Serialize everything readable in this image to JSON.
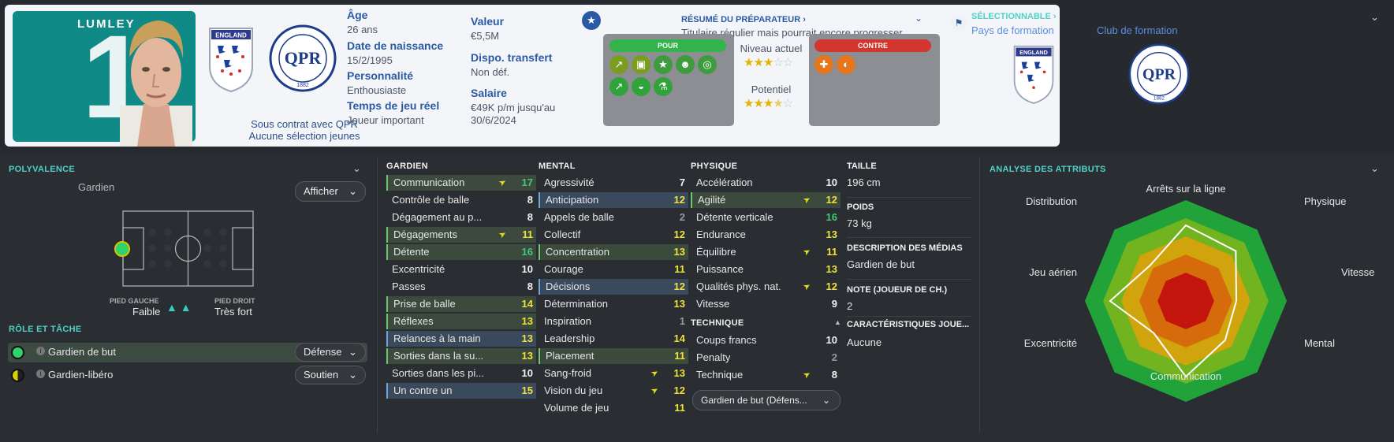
{
  "player": {
    "name": "LUMLEY",
    "number": "1",
    "contract": "Sous contrat avec QPR",
    "youth_caps": "Aucune sélection jeunes"
  },
  "info": {
    "age_label": "Âge",
    "age": "26 ans",
    "dob_label": "Date de naissance",
    "dob": "15/2/1995",
    "pers_label": "Personnalité",
    "pers": "Enthousiaste",
    "time_label": "Temps de jeu réel",
    "time": "Joueur important",
    "value_label": "Valeur",
    "value": "€5,5M",
    "transfer_label": "Dispo. transfert",
    "transfer": "Non déf.",
    "salary_label": "Salaire",
    "salary_1": "€49K p/m jusqu'au",
    "salary_2": "30/6/2024"
  },
  "coach": {
    "title": "RÉSUMÉ DU PRÉPARATEUR ›",
    "subtitle": "Titulaire régulier mais pourrait encore progresser",
    "pour": "POUR",
    "contre": "CONTRE",
    "current_label": "Niveau actuel",
    "current_stars": 3,
    "potential_label": "Potentiel",
    "potential_stars": 3.5,
    "pour_icons": [
      "kick-icon",
      "ticket-icon",
      "star-icon",
      "head-icon",
      "target-icon",
      "trend-icon",
      "shoe-icon",
      "flask-icon"
    ],
    "contre_icons": [
      "medical-cross-icon",
      "foot-icon"
    ]
  },
  "selection": {
    "title": "SÉLECTIONNABLE ›",
    "country_link": "Pays de formation",
    "club_link": "Club de formation"
  },
  "crests": {
    "england": "ENGLAND",
    "qpr_top": "QUEENS PARK RANGERS",
    "qpr_mid": "QPR",
    "qpr_year": "1882"
  },
  "polyvalence": {
    "title": "POLYVALENCE",
    "position": "Gardien",
    "show": "Afficher",
    "left_foot_label": "PIED GAUCHE",
    "left_foot": "Faible",
    "right_foot_label": "PIED DROIT",
    "right_foot": "Très fort"
  },
  "role": {
    "title": "RÔLE ET TÂCHE",
    "items": [
      {
        "name": "Gardien de but",
        "duty": "Défense"
      },
      {
        "name": "Gardien-libéro",
        "duty": "Soutien"
      }
    ]
  },
  "attributes": {
    "gardien_title": "GARDIEN",
    "gardien": [
      {
        "n": "Communication",
        "v": "17"
      },
      {
        "n": "Contrôle de balle",
        "v": "8"
      },
      {
        "n": "Dégagement au p...",
        "v": "8"
      },
      {
        "n": "Dégagements",
        "v": "11"
      },
      {
        "n": "Détente",
        "v": "16"
      },
      {
        "n": "Excentricité",
        "v": "10"
      },
      {
        "n": "Passes",
        "v": "8"
      },
      {
        "n": "Prise de balle",
        "v": "14"
      },
      {
        "n": "Réflexes",
        "v": "13"
      },
      {
        "n": "Relances à la main",
        "v": "13"
      },
      {
        "n": "Sorties dans la su...",
        "v": "13"
      },
      {
        "n": "Sorties dans les pi...",
        "v": "10"
      },
      {
        "n": "Un contre un",
        "v": "15"
      }
    ],
    "mental_title": "MENTAL",
    "mental": [
      {
        "n": "Agressivité",
        "v": "7"
      },
      {
        "n": "Anticipation",
        "v": "12"
      },
      {
        "n": "Appels de balle",
        "v": "2"
      },
      {
        "n": "Collectif",
        "v": "12"
      },
      {
        "n": "Concentration",
        "v": "13"
      },
      {
        "n": "Courage",
        "v": "11"
      },
      {
        "n": "Décisions",
        "v": "12"
      },
      {
        "n": "Détermination",
        "v": "13"
      },
      {
        "n": "Inspiration",
        "v": "1"
      },
      {
        "n": "Leadership",
        "v": "14"
      },
      {
        "n": "Placement",
        "v": "11"
      },
      {
        "n": "Sang-froid",
        "v": "13"
      },
      {
        "n": "Vision du jeu",
        "v": "12"
      },
      {
        "n": "Volume de jeu",
        "v": "11"
      }
    ],
    "physique_title": "PHYSIQUE",
    "physique": [
      {
        "n": "Accélération",
        "v": "10"
      },
      {
        "n": "Agilité",
        "v": "12"
      },
      {
        "n": "Détente verticale",
        "v": "16"
      },
      {
        "n": "Endurance",
        "v": "13"
      },
      {
        "n": "Équilibre",
        "v": "11"
      },
      {
        "n": "Puissance",
        "v": "13"
      },
      {
        "n": "Qualités phys. nat.",
        "v": "12"
      },
      {
        "n": "Vitesse",
        "v": "9"
      }
    ],
    "technique_title": "TECHNIQUE",
    "technique": [
      {
        "n": "Coups francs",
        "v": "10"
      },
      {
        "n": "Penalty",
        "v": "2"
      },
      {
        "n": "Technique",
        "v": "8"
      }
    ],
    "role_select": "Gardien de but (Défens..."
  },
  "details": {
    "height_label": "TAILLE",
    "height": "196 cm",
    "weight_label": "POIDS",
    "weight": "73 kg",
    "media_label": "DESCRIPTION DES MÉDIAS",
    "media": "Gardien de but",
    "rating_label": "NOTE (JOUEUR DE CH.)",
    "rating": "2",
    "traits_label": "CARACTÉRISTIQUES JOUE...",
    "traits": "Aucune"
  },
  "analysis": {
    "title": "ANALYSE DES ATTRIBUTS",
    "axes": [
      "Arrêts sur la ligne",
      "Physique",
      "Vitesse",
      "Mental",
      "Communication",
      "Excentricité",
      "Jeu aérien",
      "Distribution"
    ],
    "values": [
      0.75,
      0.7,
      0.5,
      0.55,
      0.75,
      0.45,
      0.75,
      0.5
    ]
  }
}
